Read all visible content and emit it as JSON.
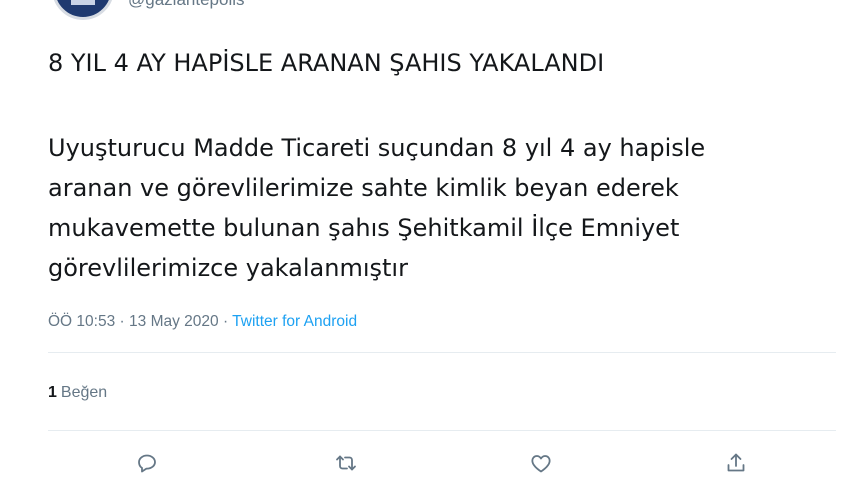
{
  "account": {
    "handle": "@gaziantepolis"
  },
  "tweet": {
    "headline": "8 YIL 4 AY HAPİSLE ARANAN ŞAHIS YAKALANDI",
    "body_lines": [
      "Uyuşturucu Madde Ticareti suçundan 8 yıl 4 ay hapisle",
      "aranan ve görevlilerimize sahte kimlik beyan ederek",
      "mukavemette bulunan şahıs Şehitkamil İlçe Emniyet",
      "görevlilerimizce yakalanmıştır"
    ],
    "time": "ÖÖ 10:53",
    "separator": "·",
    "date": "13 May 2020",
    "source": "Twitter for Android"
  },
  "stats": {
    "likes_count": "1",
    "likes_label": "Beğen"
  },
  "actions": {
    "icons": [
      "reply-icon",
      "retweet-icon",
      "like-icon",
      "share-icon"
    ]
  },
  "colors": {
    "link": "#1da1f2",
    "muted": "#657786",
    "text": "#14171a",
    "divider": "#e6ecf0"
  }
}
